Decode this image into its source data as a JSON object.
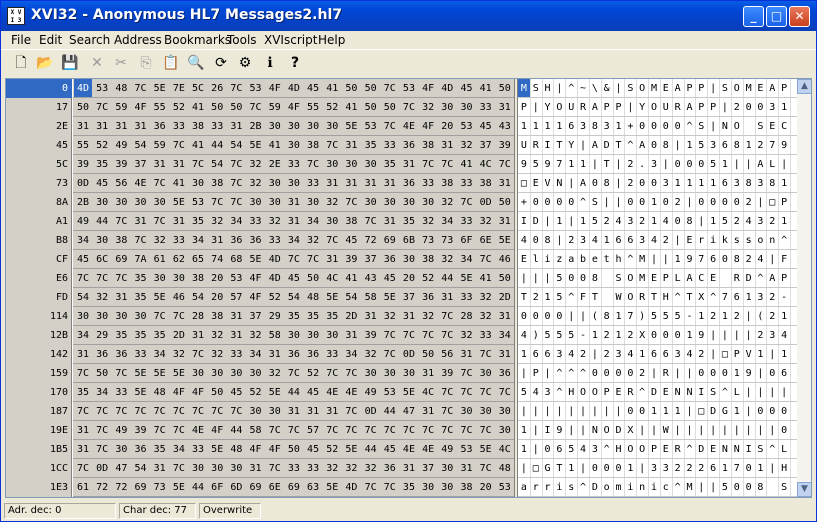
{
  "title": "XVI32 - Anonymous HL7 Messages2.hl7",
  "app_icon_text": "XVI32",
  "menu": [
    "File",
    "Edit",
    "Search",
    "Address",
    "Bookmarks",
    "Tools",
    "XVIscript",
    "Help"
  ],
  "toolbar": {
    "new": "🗋",
    "open": "📂",
    "save": "💾",
    "delete": "✕",
    "cut": "✂",
    "copy": "⎘",
    "paste": "📋",
    "find": "🔍",
    "replace": "⟳",
    "options": "⚙",
    "info": "ℹ",
    "help": "?"
  },
  "addresses": [
    "0",
    "17",
    "2E",
    "45",
    "5C",
    "73",
    "8A",
    "A1",
    "B8",
    "CF",
    "E6",
    "FD",
    "114",
    "12B",
    "142",
    "159",
    "170",
    "187",
    "19E",
    "1B5",
    "1CC",
    "1E3"
  ],
  "hex_rows": [
    [
      "4D",
      "53",
      "48",
      "7C",
      "5E",
      "7E",
      "5C",
      "26",
      "7C",
      "53",
      "4F",
      "4D",
      "45",
      "41",
      "50",
      "50",
      "7C",
      "53",
      "4F",
      "4D",
      "45",
      "41",
      "50"
    ],
    [
      "50",
      "7C",
      "59",
      "4F",
      "55",
      "52",
      "41",
      "50",
      "50",
      "7C",
      "59",
      "4F",
      "55",
      "52",
      "41",
      "50",
      "50",
      "7C",
      "32",
      "30",
      "30",
      "33",
      "31"
    ],
    [
      "31",
      "31",
      "31",
      "31",
      "36",
      "33",
      "38",
      "33",
      "31",
      "2B",
      "30",
      "30",
      "30",
      "30",
      "5E",
      "53",
      "7C",
      "4E",
      "4F",
      "20",
      "53",
      "45",
      "43"
    ],
    [
      "55",
      "52",
      "49",
      "54",
      "59",
      "7C",
      "41",
      "44",
      "54",
      "5E",
      "41",
      "30",
      "38",
      "7C",
      "31",
      "35",
      "33",
      "36",
      "38",
      "31",
      "32",
      "37",
      "39"
    ],
    [
      "39",
      "35",
      "39",
      "37",
      "31",
      "31",
      "7C",
      "54",
      "7C",
      "32",
      "2E",
      "33",
      "7C",
      "30",
      "30",
      "30",
      "35",
      "31",
      "7C",
      "7C",
      "41",
      "4C",
      "7C"
    ],
    [
      "0D",
      "45",
      "56",
      "4E",
      "7C",
      "41",
      "30",
      "38",
      "7C",
      "32",
      "30",
      "30",
      "33",
      "31",
      "31",
      "31",
      "31",
      "36",
      "33",
      "38",
      "33",
      "38",
      "31"
    ],
    [
      "2B",
      "30",
      "30",
      "30",
      "30",
      "5E",
      "53",
      "7C",
      "7C",
      "30",
      "30",
      "31",
      "30",
      "32",
      "7C",
      "30",
      "30",
      "30",
      "30",
      "32",
      "7C",
      "0D",
      "50"
    ],
    [
      "49",
      "44",
      "7C",
      "31",
      "7C",
      "31",
      "35",
      "32",
      "34",
      "33",
      "32",
      "31",
      "34",
      "30",
      "38",
      "7C",
      "31",
      "35",
      "32",
      "34",
      "33",
      "32",
      "31"
    ],
    [
      "34",
      "30",
      "38",
      "7C",
      "32",
      "33",
      "34",
      "31",
      "36",
      "36",
      "33",
      "34",
      "32",
      "7C",
      "45",
      "72",
      "69",
      "6B",
      "73",
      "73",
      "6F",
      "6E",
      "5E"
    ],
    [
      "45",
      "6C",
      "69",
      "7A",
      "61",
      "62",
      "65",
      "74",
      "68",
      "5E",
      "4D",
      "7C",
      "7C",
      "31",
      "39",
      "37",
      "36",
      "30",
      "38",
      "32",
      "34",
      "7C",
      "46"
    ],
    [
      "7C",
      "7C",
      "7C",
      "35",
      "30",
      "30",
      "38",
      "20",
      "53",
      "4F",
      "4D",
      "45",
      "50",
      "4C",
      "41",
      "43",
      "45",
      "20",
      "52",
      "44",
      "5E",
      "41",
      "50"
    ],
    [
      "54",
      "32",
      "31",
      "35",
      "5E",
      "46",
      "54",
      "20",
      "57",
      "4F",
      "52",
      "54",
      "48",
      "5E",
      "54",
      "58",
      "5E",
      "37",
      "36",
      "31",
      "33",
      "32",
      "2D"
    ],
    [
      "30",
      "30",
      "30",
      "30",
      "7C",
      "7C",
      "28",
      "38",
      "31",
      "37",
      "29",
      "35",
      "35",
      "35",
      "2D",
      "31",
      "32",
      "31",
      "32",
      "7C",
      "28",
      "32",
      "31"
    ],
    [
      "34",
      "29",
      "35",
      "35",
      "35",
      "2D",
      "31",
      "32",
      "31",
      "32",
      "58",
      "30",
      "30",
      "30",
      "31",
      "39",
      "7C",
      "7C",
      "7C",
      "7C",
      "32",
      "33",
      "34"
    ],
    [
      "31",
      "36",
      "36",
      "33",
      "34",
      "32",
      "7C",
      "32",
      "33",
      "34",
      "31",
      "36",
      "36",
      "33",
      "34",
      "32",
      "7C",
      "0D",
      "50",
      "56",
      "31",
      "7C",
      "31"
    ],
    [
      "7C",
      "50",
      "7C",
      "5E",
      "5E",
      "5E",
      "30",
      "30",
      "30",
      "30",
      "32",
      "7C",
      "52",
      "7C",
      "7C",
      "30",
      "30",
      "30",
      "31",
      "39",
      "7C",
      "30",
      "36"
    ],
    [
      "35",
      "34",
      "33",
      "5E",
      "48",
      "4F",
      "4F",
      "50",
      "45",
      "52",
      "5E",
      "44",
      "45",
      "4E",
      "4E",
      "49",
      "53",
      "5E",
      "4C",
      "7C",
      "7C",
      "7C",
      "7C"
    ],
    [
      "7C",
      "7C",
      "7C",
      "7C",
      "7C",
      "7C",
      "7C",
      "7C",
      "7C",
      "30",
      "30",
      "31",
      "31",
      "31",
      "7C",
      "0D",
      "44",
      "47",
      "31",
      "7C",
      "30",
      "30",
      "30"
    ],
    [
      "31",
      "7C",
      "49",
      "39",
      "7C",
      "7C",
      "4E",
      "4F",
      "44",
      "58",
      "7C",
      "7C",
      "57",
      "7C",
      "7C",
      "7C",
      "7C",
      "7C",
      "7C",
      "7C",
      "7C",
      "7C",
      "30"
    ],
    [
      "31",
      "7C",
      "30",
      "36",
      "35",
      "34",
      "33",
      "5E",
      "48",
      "4F",
      "4F",
      "50",
      "45",
      "52",
      "5E",
      "44",
      "45",
      "4E",
      "4E",
      "49",
      "53",
      "5E",
      "4C"
    ],
    [
      "7C",
      "0D",
      "47",
      "54",
      "31",
      "7C",
      "30",
      "30",
      "30",
      "31",
      "7C",
      "33",
      "33",
      "32",
      "32",
      "32",
      "36",
      "31",
      "37",
      "30",
      "31",
      "7C",
      "48"
    ],
    [
      "61",
      "72",
      "72",
      "69",
      "73",
      "5E",
      "44",
      "6F",
      "6D",
      "69",
      "6E",
      "69",
      "63",
      "5E",
      "4D",
      "7C",
      "7C",
      "35",
      "30",
      "30",
      "38",
      "20",
      "53"
    ]
  ],
  "ascii_rows": [
    [
      "M",
      "S",
      "H",
      "|",
      "^",
      "~",
      "\\",
      "&",
      "|",
      "S",
      "O",
      "M",
      "E",
      "A",
      "P",
      "P",
      "|",
      "S",
      "O",
      "M",
      "E",
      "A",
      "P"
    ],
    [
      "P",
      "|",
      "Y",
      "O",
      "U",
      "R",
      "A",
      "P",
      "P",
      "|",
      "Y",
      "O",
      "U",
      "R",
      "A",
      "P",
      "P",
      "|",
      "2",
      "0",
      "0",
      "3",
      "1"
    ],
    [
      "1",
      "1",
      "1",
      "1",
      "6",
      "3",
      "8",
      "3",
      "1",
      "+",
      "0",
      "0",
      "0",
      "0",
      "^",
      "S",
      "|",
      "N",
      "O",
      " ",
      "S",
      "E",
      "C"
    ],
    [
      "U",
      "R",
      "I",
      "T",
      "Y",
      "|",
      "A",
      "D",
      "T",
      "^",
      "A",
      "0",
      "8",
      "|",
      "1",
      "5",
      "3",
      "6",
      "8",
      "1",
      "2",
      "7",
      "9"
    ],
    [
      "9",
      "5",
      "9",
      "7",
      "1",
      "1",
      "|",
      "T",
      "|",
      "2",
      ".",
      "3",
      "|",
      "0",
      "0",
      "0",
      "5",
      "1",
      "|",
      "|",
      "A",
      "L",
      "|"
    ],
    [
      "□",
      "E",
      "V",
      "N",
      "|",
      "A",
      "0",
      "8",
      "|",
      "2",
      "0",
      "0",
      "3",
      "1",
      "1",
      "1",
      "1",
      "6",
      "3",
      "8",
      "3",
      "8",
      "1"
    ],
    [
      "+",
      "0",
      "0",
      "0",
      "0",
      "^",
      "S",
      "|",
      "|",
      "0",
      "0",
      "1",
      "0",
      "2",
      "|",
      "0",
      "0",
      "0",
      "0",
      "2",
      "|",
      "□",
      "P"
    ],
    [
      "I",
      "D",
      "|",
      "1",
      "|",
      "1",
      "5",
      "2",
      "4",
      "3",
      "2",
      "1",
      "4",
      "0",
      "8",
      "|",
      "1",
      "5",
      "2",
      "4",
      "3",
      "2",
      "1"
    ],
    [
      "4",
      "0",
      "8",
      "|",
      "2",
      "3",
      "4",
      "1",
      "6",
      "6",
      "3",
      "4",
      "2",
      "|",
      "E",
      "r",
      "i",
      "k",
      "s",
      "s",
      "o",
      "n",
      "^"
    ],
    [
      "E",
      "l",
      "i",
      "z",
      "a",
      "b",
      "e",
      "t",
      "h",
      "^",
      "M",
      "|",
      "|",
      "1",
      "9",
      "7",
      "6",
      "0",
      "8",
      "2",
      "4",
      "|",
      "F"
    ],
    [
      "|",
      "|",
      "|",
      "5",
      "0",
      "0",
      "8",
      " ",
      "S",
      "O",
      "M",
      "E",
      "P",
      "L",
      "A",
      "C",
      "E",
      " ",
      "R",
      "D",
      "^",
      "A",
      "P"
    ],
    [
      "T",
      "2",
      "1",
      "5",
      "^",
      "F",
      "T",
      " ",
      "W",
      "O",
      "R",
      "T",
      "H",
      "^",
      "T",
      "X",
      "^",
      "7",
      "6",
      "1",
      "3",
      "2",
      "-"
    ],
    [
      "0",
      "0",
      "0",
      "0",
      "|",
      "|",
      "(",
      "8",
      "1",
      "7",
      ")",
      "5",
      "5",
      "5",
      "-",
      "1",
      "2",
      "1",
      "2",
      "|",
      "(",
      "2",
      "1"
    ],
    [
      "4",
      ")",
      "5",
      "5",
      "5",
      "-",
      "1",
      "2",
      "1",
      "2",
      "X",
      "0",
      "0",
      "0",
      "1",
      "9",
      "|",
      "|",
      "|",
      "|",
      "2",
      "3",
      "4"
    ],
    [
      "1",
      "6",
      "6",
      "3",
      "4",
      "2",
      "|",
      "2",
      "3",
      "4",
      "1",
      "6",
      "6",
      "3",
      "4",
      "2",
      "|",
      "□",
      "P",
      "V",
      "1",
      "|",
      "1"
    ],
    [
      "|",
      "P",
      "|",
      "^",
      "^",
      "^",
      "0",
      "0",
      "0",
      "0",
      "2",
      "|",
      "R",
      "|",
      "|",
      "0",
      "0",
      "0",
      "1",
      "9",
      "|",
      "0",
      "6"
    ],
    [
      "5",
      "4",
      "3",
      "^",
      "H",
      "O",
      "O",
      "P",
      "E",
      "R",
      "^",
      "D",
      "E",
      "N",
      "N",
      "I",
      "S",
      "^",
      "L",
      "|",
      "|",
      "|",
      "|"
    ],
    [
      "|",
      "|",
      "|",
      "|",
      "|",
      "|",
      "|",
      "|",
      "|",
      "0",
      "0",
      "1",
      "1",
      "1",
      "|",
      "□",
      "D",
      "G",
      "1",
      "|",
      "0",
      "0",
      "0"
    ],
    [
      "1",
      "|",
      "I",
      "9",
      "|",
      "|",
      "N",
      "O",
      "D",
      "X",
      "|",
      "|",
      "W",
      "|",
      "|",
      "|",
      "|",
      "|",
      "|",
      "|",
      "|",
      "|",
      "0"
    ],
    [
      "1",
      "|",
      "0",
      "6",
      "5",
      "4",
      "3",
      "^",
      "H",
      "O",
      "O",
      "P",
      "E",
      "R",
      "^",
      "D",
      "E",
      "N",
      "N",
      "I",
      "S",
      "^",
      "L"
    ],
    [
      "|",
      "□",
      "G",
      "T",
      "1",
      "|",
      "0",
      "0",
      "0",
      "1",
      "|",
      "3",
      "3",
      "2",
      "2",
      "2",
      "6",
      "1",
      "7",
      "0",
      "1",
      "|",
      "H"
    ],
    [
      "a",
      "r",
      "r",
      "i",
      "s",
      "^",
      "D",
      "o",
      "m",
      "i",
      "n",
      "i",
      "c",
      "^",
      "M",
      "|",
      "|",
      "5",
      "0",
      "0",
      "8",
      " ",
      "S"
    ]
  ],
  "status": {
    "adr": "Adr. dec: 0",
    "char": "Char dec: 77",
    "mode": "Overwrite"
  },
  "colors": {
    "selection": "#316ac5",
    "titlebar": "#0a5de6",
    "hex_bg": "#d4d0c8"
  }
}
